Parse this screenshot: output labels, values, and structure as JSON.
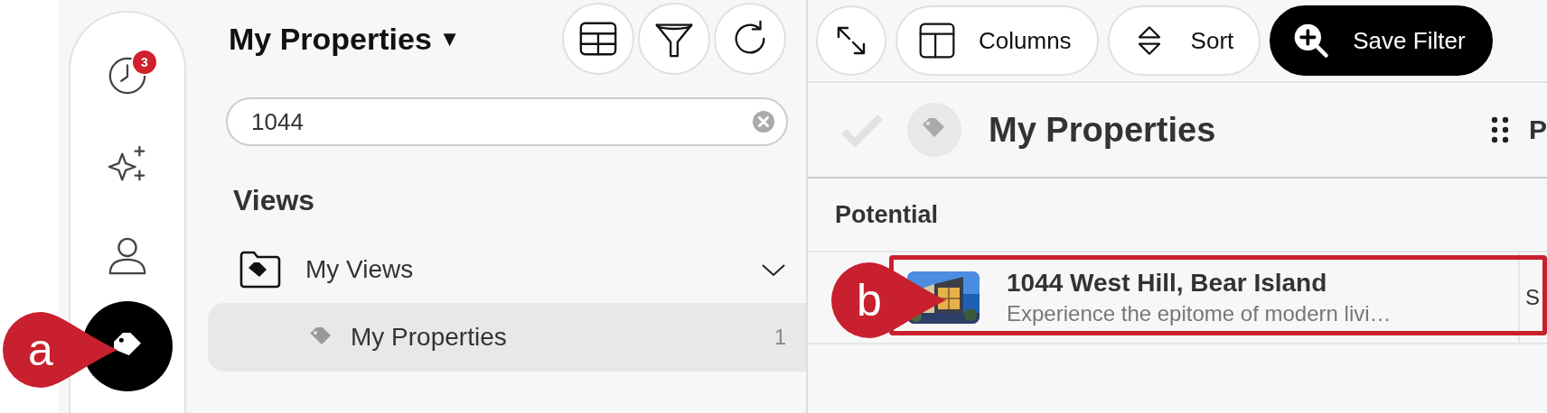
{
  "rail": {
    "items": [
      {
        "kind": "clock",
        "badge": "3",
        "selected": false
      },
      {
        "kind": "sparkles",
        "selected": false
      },
      {
        "kind": "person",
        "selected": false
      },
      {
        "kind": "tag",
        "selected": true
      }
    ]
  },
  "list_panel": {
    "title": "My Properties",
    "title_caret": "▼",
    "tool_buttons": [
      {
        "kind": "table"
      },
      {
        "kind": "filter"
      },
      {
        "kind": "refresh"
      }
    ],
    "search": {
      "value": "1044"
    },
    "section_title": "Views",
    "tree": [
      {
        "label": "My Views",
        "expanded": true,
        "children": [
          {
            "label": "My Properties",
            "count": "1",
            "selected": true
          }
        ]
      }
    ]
  },
  "toolbar": {
    "buttons": [
      {
        "kind": "expand"
      },
      {
        "kind": "columns",
        "label": "Columns",
        "primary": false
      },
      {
        "kind": "sort",
        "label": "Sort",
        "primary": false
      },
      {
        "kind": "zoom-plus",
        "label": "Save Filter",
        "primary": true
      }
    ]
  },
  "board": {
    "title": "My Properties",
    "column_2_partial": "P",
    "group": "Potential",
    "cards": [
      {
        "title": "1044 West Hill, Bear Island",
        "description": "Experience the epitome of modern livi…",
        "column_2_partial": "S",
        "highlighted": true
      }
    ]
  },
  "callouts": [
    {
      "label": "a"
    },
    {
      "label": "b"
    }
  ]
}
